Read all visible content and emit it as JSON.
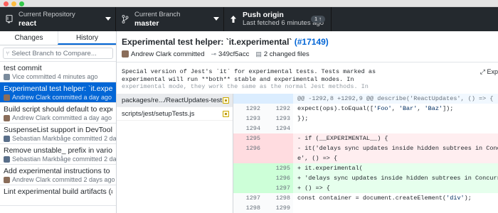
{
  "toolbar": {
    "repo_label": "Current Repository",
    "repo_name": "react",
    "branch_label": "Current Branch",
    "branch_name": "master",
    "push_label": "Push origin",
    "push_sub": "Last fetched 6 minutes ago",
    "push_badge": "1"
  },
  "tabs": {
    "changes": "Changes",
    "history": "History"
  },
  "filter": {
    "placeholder": "Select Branch to Compare..."
  },
  "commits": [
    {
      "title": "test commit",
      "meta": "Vice committed 4 minutes ago",
      "selected": false
    },
    {
      "title": "Experimental test helper: `it.experimental`",
      "meta": "Andrew Clark committed a day ago",
      "selected": true
    },
    {
      "title": "Build script should default to experi...",
      "meta": "Andrew Clark committed a day ago",
      "selected": false
    },
    {
      "title": "SuspenseList support in DevTools (#...",
      "meta": "Sebastian Markbåge committed 2 days...",
      "selected": false
    },
    {
      "title": "Remove unstable_ prefix in various in...",
      "meta": "Sebastian Markbåge committed 2 days...",
      "selected": false
    },
    {
      "title": "Add experimental instructions to rele...",
      "meta": "Andrew Clark committed 2 days ago",
      "selected": false
    },
    {
      "title": "Lint experimental build artifacts (#17...",
      "meta": "",
      "selected": false
    }
  ],
  "commit_detail": {
    "title": "Experimental test helper: `it.experimental`",
    "pr": "(#17149)",
    "author": "Andrew Clark committed",
    "sha": "349cf5acc",
    "files_changed": "2 changed files",
    "description_lines": [
      "Special version of Jest's `it` for experimental tests. Tests marked as",
      "experimental will run **both** stable and experimental modes. In",
      "experimental mode, they work the same as the normal Jest methods. In"
    ],
    "expand_label": "Exp"
  },
  "files": [
    {
      "path": "packages/re.../ReactUpdates-test.js",
      "selected": true
    },
    {
      "path": "scripts/jest/setupTests.js",
      "selected": false
    }
  ],
  "diff": {
    "hunk": "@@ -1292,8 +1292,9 @@ describe('ReactUpdates', () => {",
    "lines": [
      {
        "type": "ctx",
        "old": "1292",
        "new": "1292",
        "text": "      expect(ops).toEqual(['Foo', 'Bar', 'Baz']);"
      },
      {
        "type": "ctx",
        "old": "1293",
        "new": "1293",
        "text": "    });"
      },
      {
        "type": "ctx",
        "old": "1294",
        "new": "1294",
        "text": ""
      },
      {
        "type": "del",
        "old": "1295",
        "new": "",
        "text": "-   if (__EXPERIMENTAL__) {"
      },
      {
        "type": "del",
        "old": "1296",
        "new": "",
        "text": "-     it('delays sync updates inside hidden subtrees in Concurrent"
      },
      {
        "type": "del",
        "old": "",
        "new": "",
        "text": "    e', () => {"
      },
      {
        "type": "add",
        "old": "",
        "new": "1295",
        "text": "+   it.experimental("
      },
      {
        "type": "add",
        "old": "",
        "new": "1296",
        "text": "+     'delays sync updates inside hidden subtrees in Concurrent Mo"
      },
      {
        "type": "add",
        "old": "",
        "new": "1297",
        "text": "+     () => {"
      },
      {
        "type": "ctx",
        "old": "1297",
        "new": "1298",
        "text": "        const container = document.createElement('div');"
      },
      {
        "type": "ctx",
        "old": "1298",
        "new": "1299",
        "text": ""
      },
      {
        "type": "ctx",
        "old": "1299",
        "new": "1300",
        "text": "        function Baz() {"
      }
    ]
  },
  "colors": {
    "toolbar_bg": "#24292e",
    "selection": "#0366d6",
    "deleted_bg": "#ffeef0",
    "added_bg": "#e6ffed"
  }
}
